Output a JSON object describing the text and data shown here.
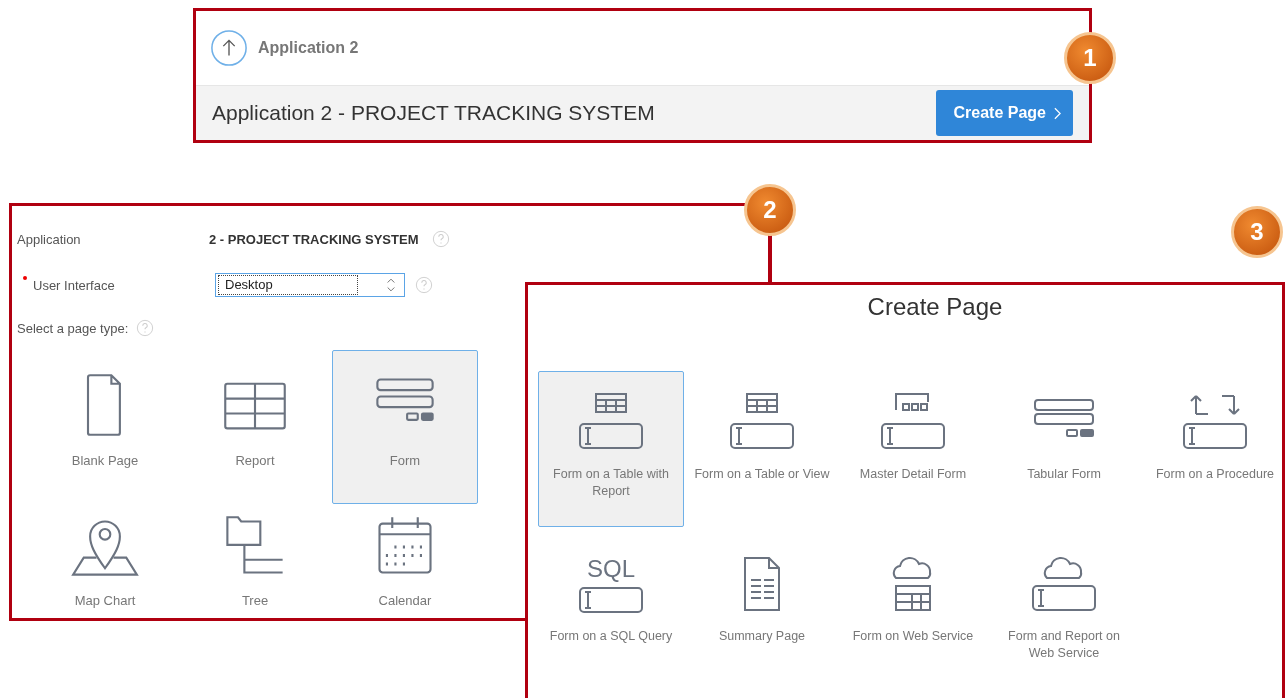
{
  "header": {
    "breadcrumb": "Application 2",
    "title": "Application 2 - PROJECT TRACKING SYSTEM",
    "button": "Create Page"
  },
  "wizard": {
    "application_label": "Application",
    "application_value": "2 - PROJECT TRACKING SYSTEM",
    "ui_label": "User Interface",
    "ui_required": true,
    "ui_value": "Desktop",
    "page_type_label": "Select a page type:",
    "page_types": [
      {
        "label": "Blank Page",
        "kind": "blank",
        "selected": false
      },
      {
        "label": "Report",
        "kind": "report",
        "selected": false
      },
      {
        "label": "Form",
        "kind": "form",
        "selected": true
      },
      {
        "label": "Map Chart",
        "kind": "map",
        "selected": false
      },
      {
        "label": "Tree",
        "kind": "tree",
        "selected": false
      },
      {
        "label": "Calendar",
        "kind": "calendar",
        "selected": false
      }
    ]
  },
  "create_page": {
    "title": "Create Page",
    "types": [
      {
        "label": "Form on a Table with Report",
        "kind": "table-input",
        "selected": true
      },
      {
        "label": "Form on a Table or View",
        "kind": "table-input",
        "selected": false
      },
      {
        "label": "Master Detail Form",
        "kind": "master-detail",
        "selected": false
      },
      {
        "label": "Tabular Form",
        "kind": "tabular",
        "selected": false
      },
      {
        "label": "Form on a Procedure",
        "kind": "procedure",
        "selected": false
      },
      {
        "label": "Form on a SQL Query",
        "kind": "sql-input",
        "icon_text": "SQL",
        "selected": false
      },
      {
        "label": "Summary Page",
        "kind": "summary",
        "selected": false
      },
      {
        "label": "Form on Web Service",
        "kind": "cloud-table",
        "selected": false
      },
      {
        "label": "Form and Report on Web Service",
        "kind": "cloud-input",
        "selected": false
      }
    ]
  },
  "callouts": [
    "1",
    "2",
    "3"
  ]
}
